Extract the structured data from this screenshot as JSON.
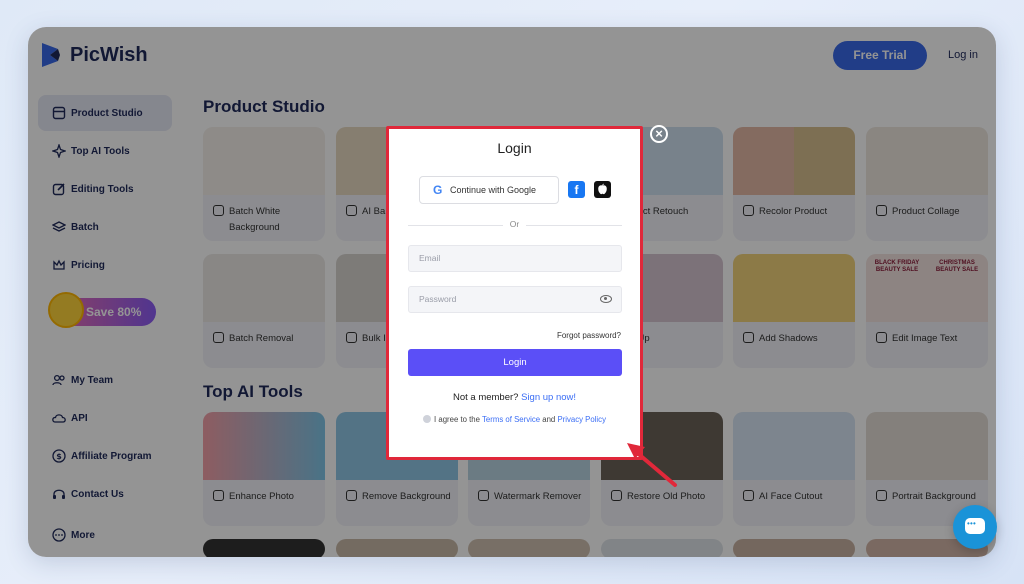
{
  "header": {
    "brand": "PicWish",
    "free_trial": "Free Trial",
    "login": "Log in"
  },
  "sidebar": {
    "items": [
      {
        "label": "Product Studio",
        "icon": "product-studio-icon"
      },
      {
        "label": "Top AI Tools",
        "icon": "sparkle-icon"
      },
      {
        "label": "Editing Tools",
        "icon": "edit-icon"
      },
      {
        "label": "Batch",
        "icon": "layers-icon"
      },
      {
        "label": "Pricing",
        "icon": "crown-icon"
      },
      {
        "label": "My Team",
        "icon": "team-icon"
      },
      {
        "label": "API",
        "icon": "cloud-icon"
      },
      {
        "label": "Affiliate Program",
        "icon": "dollar-icon"
      },
      {
        "label": "Contact Us",
        "icon": "headset-icon"
      },
      {
        "label": "More",
        "icon": "more-icon"
      }
    ],
    "save_badge": "Save 80%"
  },
  "main": {
    "product_studio_title": "Product Studio",
    "top_ai_tools_title": "Top AI Tools",
    "product_cards": [
      "Batch White Background",
      "AI Ba",
      "oduct Retouch",
      "Recolor Product",
      "Product Collage",
      "Batch Removal",
      "Bulk I Wate",
      "nt Up",
      "Add Shadows",
      "Edit Image Text"
    ],
    "ai_cards": [
      "Enhance Photo",
      "Remove Background",
      "Watermark Remover",
      "Restore Old Photo",
      "AI Face Cutout",
      "Portrait Background"
    ],
    "thumb_text": {
      "black_friday": "BLACK FRIDAY BEAUTY SALE",
      "christmas": "CHRISTMAS BEAUTY SALE"
    }
  },
  "modal": {
    "title": "Login",
    "google": "Continue with Google",
    "or": "Or",
    "email_placeholder": "Email",
    "password_placeholder": "Password",
    "forgot": "Forgot password?",
    "login_button": "Login",
    "member_text": "Not a member?",
    "signup": "Sign up now!",
    "agree_text": "I agree to the",
    "terms": "Terms of Service",
    "and": "and",
    "privacy": "Privacy Policy"
  },
  "colors": {
    "accent": "#5b4ff7",
    "highlight": "#e0283a",
    "brand_blue": "#3a6ae8"
  }
}
